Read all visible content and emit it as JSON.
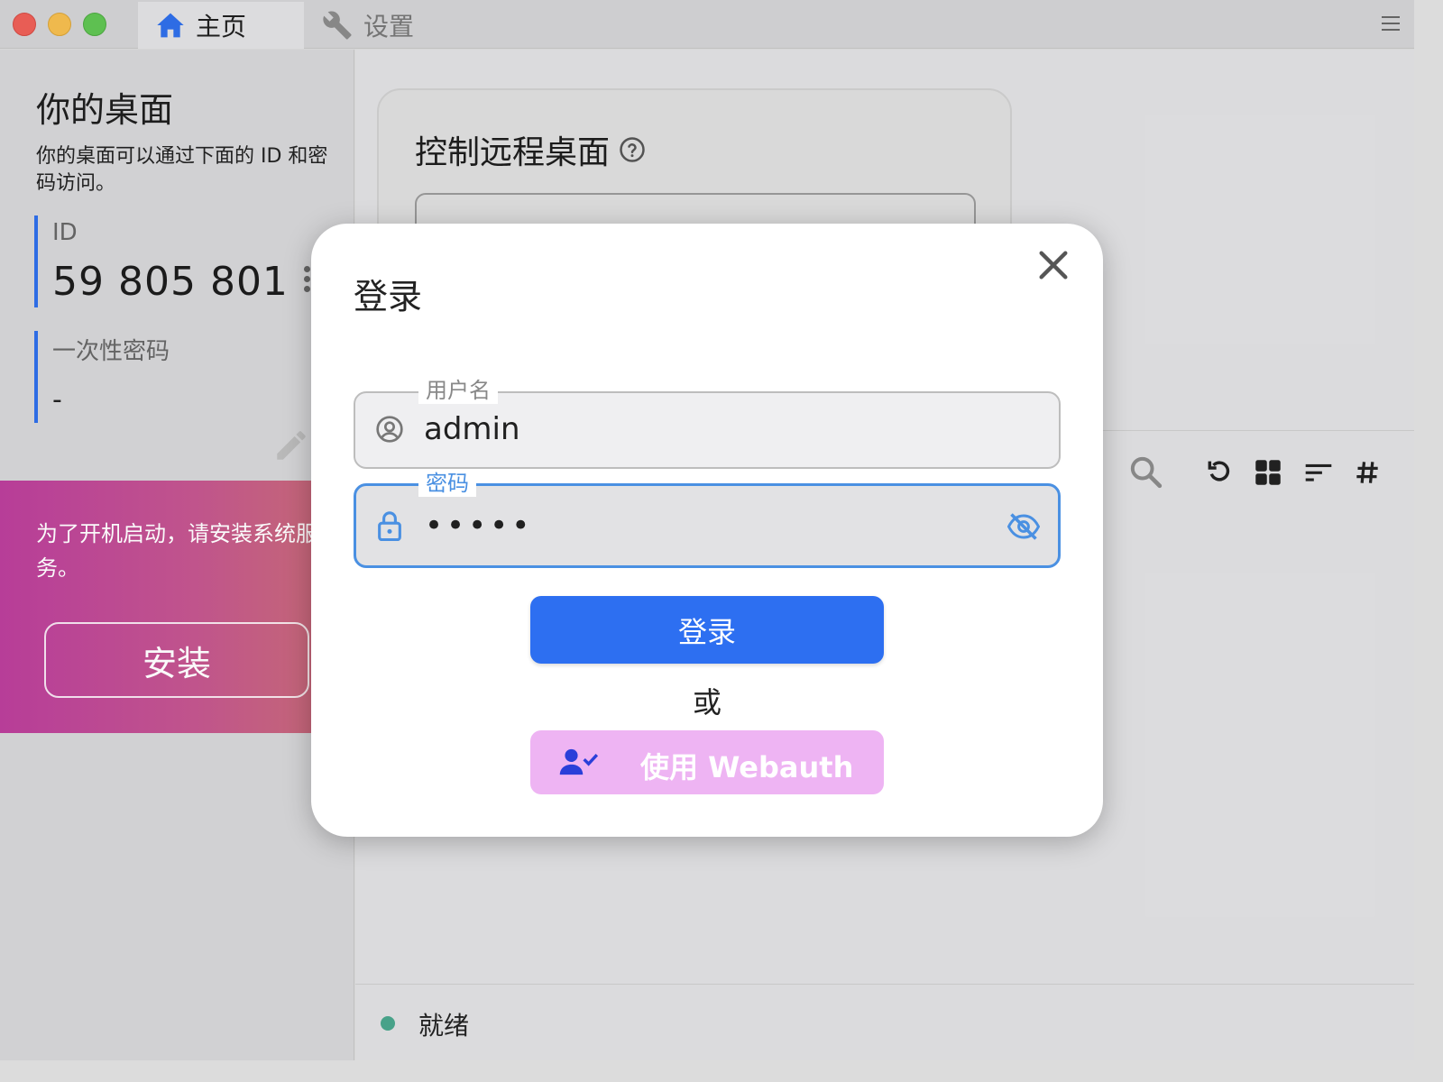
{
  "window": {
    "tabs": [
      {
        "label": "主页",
        "icon": "home-icon",
        "active": true
      },
      {
        "label": "设置",
        "icon": "wrench-icon",
        "active": false
      }
    ]
  },
  "sidebar": {
    "title": "你的桌面",
    "description": "你的桌面可以通过下面的 ID 和密码访问。",
    "id_label": "ID",
    "id_value": "59 805 801",
    "password_label": "一次性密码",
    "password_value": "-",
    "install_banner": {
      "text": "为了开机启动，请安装系统服务。",
      "button": "安装"
    }
  },
  "main": {
    "control_title": "控制远程桌面",
    "status_text": "就绪"
  },
  "login_dialog": {
    "title": "登录",
    "username_label": "用户名",
    "username_value": "admin",
    "password_label": "密码",
    "password_value": "•••••",
    "login_button": "登录",
    "or_text": "或",
    "webauth_button": "使用 Webauth"
  },
  "colors": {
    "accent": "#2d6ff1",
    "focus": "#4a90e2",
    "webauth": "#eeb4f3",
    "status_ready": "#4aa68c"
  }
}
